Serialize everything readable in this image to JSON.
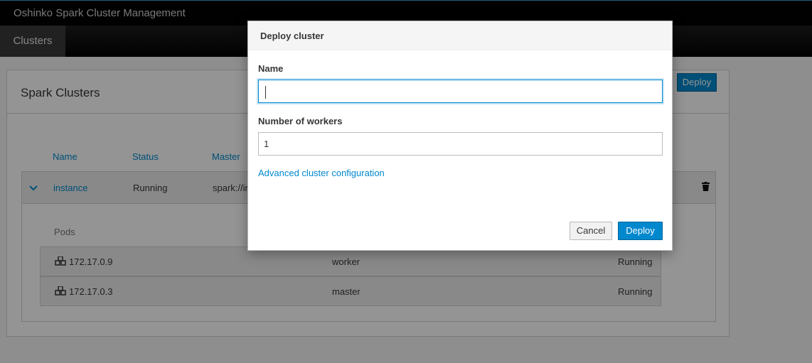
{
  "header": {
    "app_title": "Oshinko Spark Cluster Management",
    "nav_tabs": [
      {
        "label": "Clusters"
      }
    ]
  },
  "page": {
    "card_title": "Spark Clusters",
    "deploy_label": "Deploy",
    "columns": [
      "Name",
      "Status",
      "Master"
    ],
    "cluster": {
      "name": "instance",
      "status": "Running",
      "master": "spark://in"
    },
    "pods_label": "Pods",
    "pods": [
      {
        "ip": "172.17.0.9",
        "role": "worker",
        "status": "Running"
      },
      {
        "ip": "172.17.0.3",
        "role": "master",
        "status": "Running"
      }
    ]
  },
  "modal": {
    "title": "Deploy cluster",
    "name_label": "Name",
    "name_value": "",
    "workers_label": "Number of workers",
    "workers_value": "1",
    "advanced_link": "Advanced cluster configuration",
    "cancel_label": "Cancel",
    "deploy_label": "Deploy"
  },
  "colors": {
    "accent": "#0088ce",
    "topbar": "#030303",
    "overlay": "rgba(0,0,0,0.42)"
  },
  "icons": {
    "chevron": "chevron-down-icon",
    "trash": "trash-icon",
    "pod": "cubes-icon"
  }
}
